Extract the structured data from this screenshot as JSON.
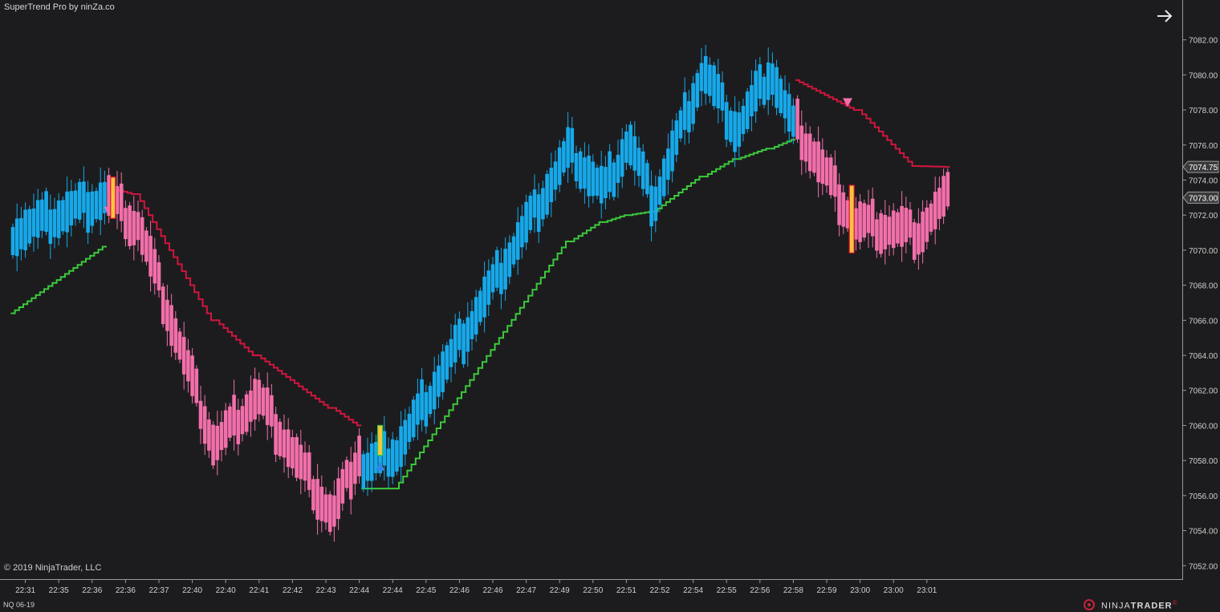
{
  "indicator_label": "SuperTrend Pro by ninZa.co",
  "copyright": "© 2019 NinjaTrader, LLC",
  "instrument": "NQ 06-19",
  "logo": {
    "prefix": "NINJA",
    "suffix": "TRADER",
    "mark": "®"
  },
  "colors": {
    "background": "#1c1c1e",
    "bull": "#16a9ea",
    "bear": "#f26faa",
    "uptrend": "#3cc93c",
    "downtrend": "#d0163e",
    "signal_up": "#2f86e6",
    "signal_down": "#f26faa"
  },
  "chart_data": {
    "type": "candlestick",
    "y_axis": {
      "min": 7051.6,
      "max": 7082.9,
      "ticks": [
        7052,
        7054,
        7056,
        7058,
        7060,
        7062,
        7064,
        7066,
        7068,
        7070,
        7072,
        7074,
        7076,
        7078,
        7080,
        7082
      ],
      "tick_labels": [
        "7052.00",
        "7054.00",
        "7056.00",
        "7058.00",
        "7060.00",
        "7062.00",
        "7064.00",
        "7066.00",
        "7068.00",
        "7070.00",
        "7072.00",
        "7074.00",
        "7076.00",
        "7078.00",
        "7080.00",
        "7082.00"
      ]
    },
    "x_axis": {
      "tick_labels": [
        "22:31",
        "22:35",
        "22:36",
        "22:36",
        "22:37",
        "22:40",
        "22:40",
        "22:41",
        "22:42",
        "22:43",
        "22:44",
        "22:44",
        "22:45",
        "22:46",
        "22:46",
        "22:47",
        "22:49",
        "22:50",
        "22:51",
        "22:52",
        "22:54",
        "22:55",
        "22:56",
        "22:58",
        "22:59",
        "23:00",
        "23:00",
        "23:01"
      ],
      "tick_bar_index": [
        3,
        11,
        19,
        27,
        35,
        43,
        51,
        59,
        67,
        75,
        83,
        91,
        99,
        107,
        115,
        123,
        131,
        139,
        147,
        155,
        163,
        171,
        179,
        187,
        195,
        203,
        211,
        219
      ]
    },
    "price_badges": [
      {
        "value": "7074.75",
        "ref": "supertrend"
      },
      {
        "value": "7073.00",
        "ref": "last_close"
      }
    ],
    "segments": [
      {
        "name": "up",
        "direction": "up",
        "length": 23,
        "start": 7071.0,
        "end": 7073.0,
        "start_trend": 7066.4,
        "end_trend": 7070.2
      },
      {
        "name": "down",
        "direction": "down",
        "length": 7,
        "start": 7073.0,
        "end": 7071.5,
        "start_trend": 7073.6,
        "end_trend": 7073.2
      },
      {
        "name": "down",
        "direction": "down",
        "length": 19,
        "start": 7071.5,
        "end": 7059.0,
        "start_trend": 7073.2,
        "end_trend": 7066.0
      },
      {
        "name": "down",
        "direction": "down",
        "length": 10,
        "start": 7059.0,
        "end": 7061.5,
        "start_trend": 7066.0,
        "end_trend": 7064.0
      },
      {
        "name": "down",
        "direction": "down",
        "length": 18,
        "start": 7061.5,
        "end": 7055.0,
        "start_trend": 7064.0,
        "end_trend": 7061.0
      },
      {
        "name": "down",
        "direction": "down",
        "length": 7,
        "start": 7055.0,
        "end": 7058.5,
        "start_trend": 7061.0,
        "end_trend": 7060.0
      },
      {
        "name": "up",
        "direction": "up",
        "length": 8,
        "start": 7057.5,
        "end": 7058.5,
        "start_trend": 7056.4,
        "end_trend": 7056.4
      },
      {
        "name": "up",
        "direction": "up",
        "length": 42,
        "start": 7058.5,
        "end": 7075.5,
        "start_trend": 7056.4,
        "end_trend": 7070.5
      },
      {
        "name": "up",
        "direction": "up",
        "length": 8,
        "start": 7075.5,
        "end": 7073.5,
        "start_trend": 7070.5,
        "end_trend": 7071.6
      },
      {
        "name": "up",
        "direction": "up",
        "length": 6,
        "start": 7073.5,
        "end": 7076.0,
        "start_trend": 7071.6,
        "end_trend": 7072.0
      },
      {
        "name": "up",
        "direction": "up",
        "length": 6,
        "start": 7076.0,
        "end": 7073.0,
        "start_trend": 7072.0,
        "end_trend": 7072.2
      },
      {
        "name": "up",
        "direction": "up",
        "length": 12,
        "start": 7073.0,
        "end": 7080.0,
        "start_trend": 7072.2,
        "end_trend": 7074.2
      },
      {
        "name": "up",
        "direction": "up",
        "length": 8,
        "start": 7080.0,
        "end": 7077.0,
        "start_trend": 7074.2,
        "end_trend": 7075.2
      },
      {
        "name": "up",
        "direction": "up",
        "length": 8,
        "start": 7077.0,
        "end": 7080.0,
        "start_trend": 7075.2,
        "end_trend": 7075.8
      },
      {
        "name": "up",
        "direction": "up",
        "length": 6,
        "start": 7080.0,
        "end": 7077.0,
        "start_trend": 7075.8,
        "end_trend": 7076.3
      },
      {
        "name": "down",
        "direction": "down",
        "length": 15,
        "start": 7077.0,
        "end": 7071.5,
        "start_trend": 7079.7,
        "end_trend": 7078.0
      },
      {
        "name": "down",
        "direction": "down",
        "length": 14,
        "start": 7071.5,
        "end": 7071.0,
        "start_trend": 7078.0,
        "end_trend": 7074.8
      },
      {
        "name": "down",
        "direction": "down",
        "length": 8,
        "start": 7071.0,
        "end": 7073.0,
        "start_trend": 7074.8,
        "end_trend": 7074.75
      }
    ],
    "signals": [
      {
        "type": "sell",
        "bar_index": 23,
        "price": 7072.2
      },
      {
        "type": "buy",
        "bar_index": 88,
        "price": 7057.7
      },
      {
        "type": "sell",
        "bar_index": 200,
        "price": 7078.4
      }
    ],
    "legend": "none",
    "grid": false
  }
}
